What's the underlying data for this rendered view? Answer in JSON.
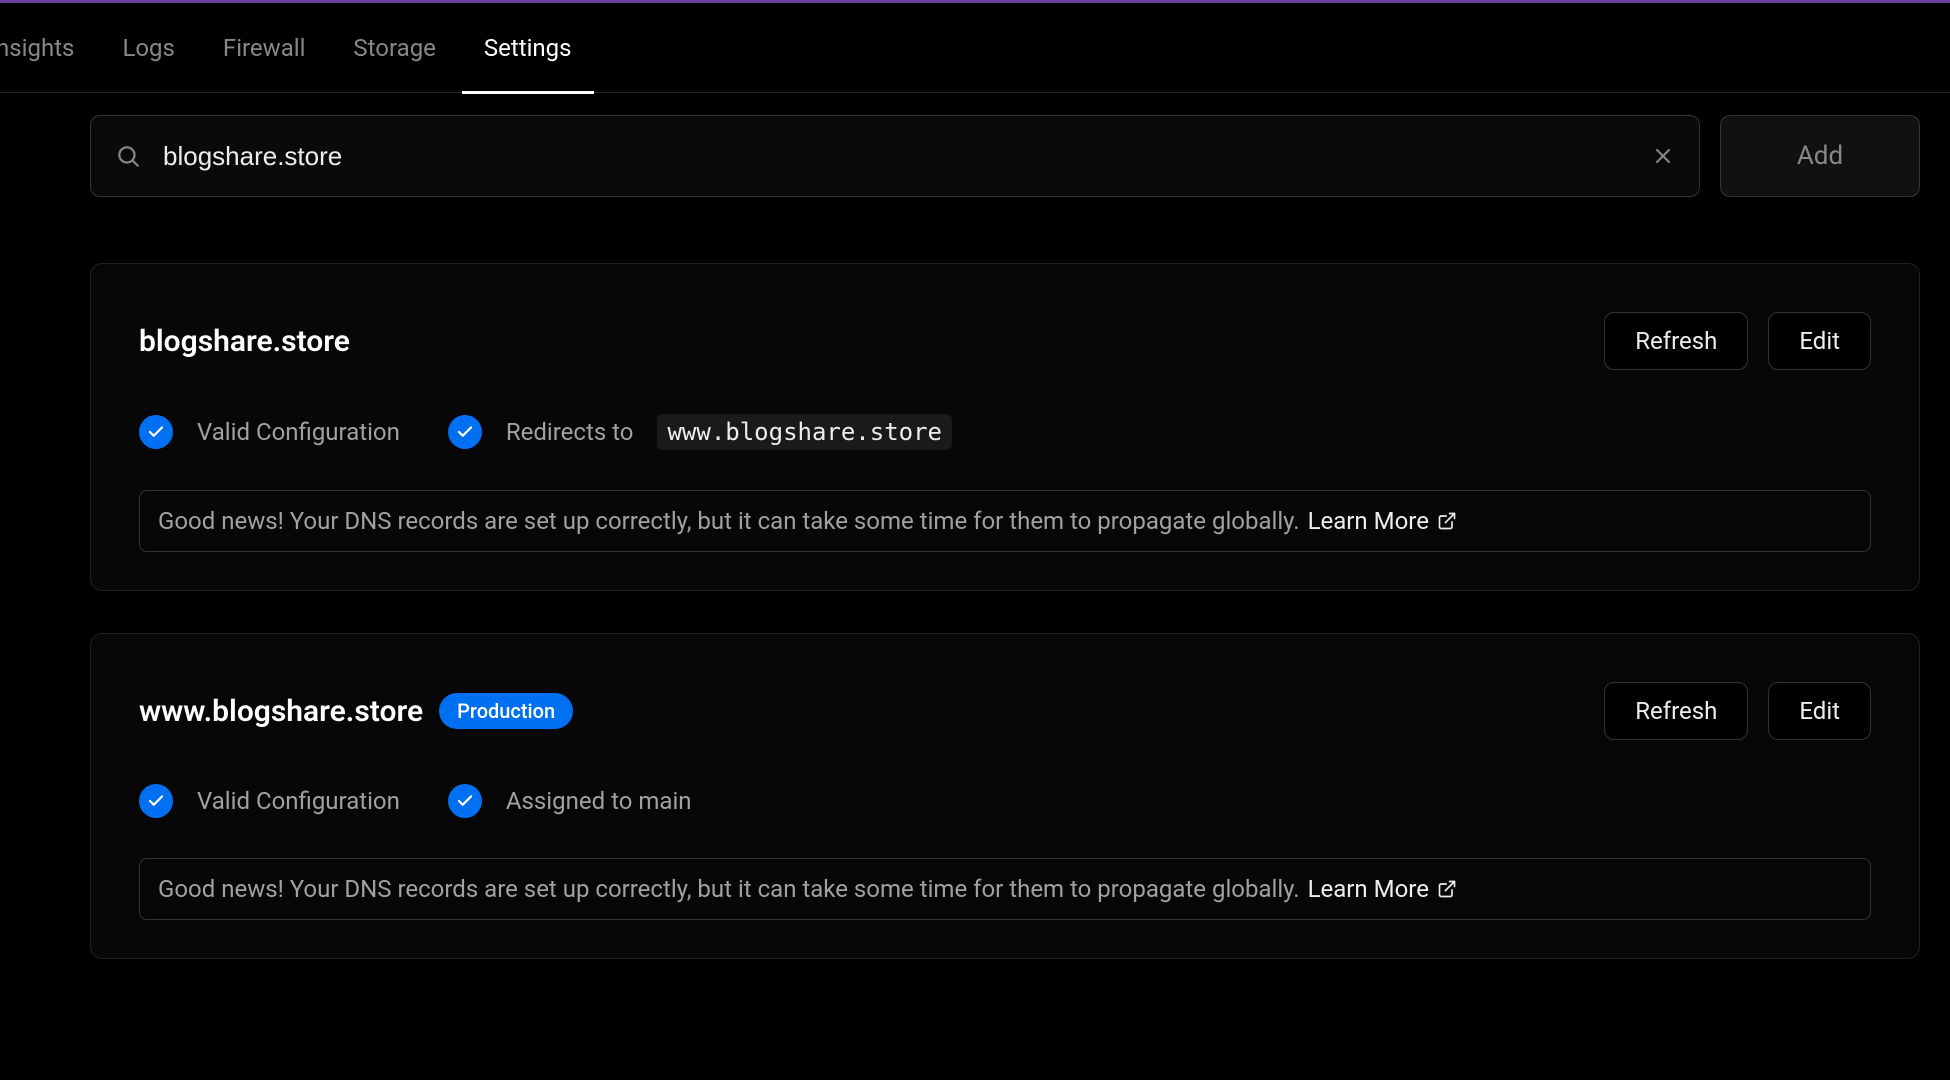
{
  "nav": {
    "items": [
      {
        "label": "d Insights"
      },
      {
        "label": "Logs"
      },
      {
        "label": "Firewall"
      },
      {
        "label": "Storage"
      },
      {
        "label": "Settings",
        "active": true
      }
    ]
  },
  "search": {
    "value": "blogshare.store",
    "add_label": "Add"
  },
  "domains": [
    {
      "name": "blogshare.store",
      "badge": null,
      "refresh_label": "Refresh",
      "edit_label": "Edit",
      "statuses": [
        {
          "label": "Valid Configuration"
        },
        {
          "label_prefix": "Redirects to",
          "code": "www.blogshare.store"
        }
      ],
      "notice_text": "Good news! Your DNS records are set up correctly, but it can take some time for them to propagate globally.",
      "learn_more": "Learn More"
    },
    {
      "name": "www.blogshare.store",
      "badge": "Production",
      "refresh_label": "Refresh",
      "edit_label": "Edit",
      "statuses": [
        {
          "label": "Valid Configuration"
        },
        {
          "label": "Assigned to main"
        }
      ],
      "notice_text": "Good news! Your DNS records are set up correctly, but it can take some time for them to propagate globally.",
      "learn_more": "Learn More"
    }
  ]
}
